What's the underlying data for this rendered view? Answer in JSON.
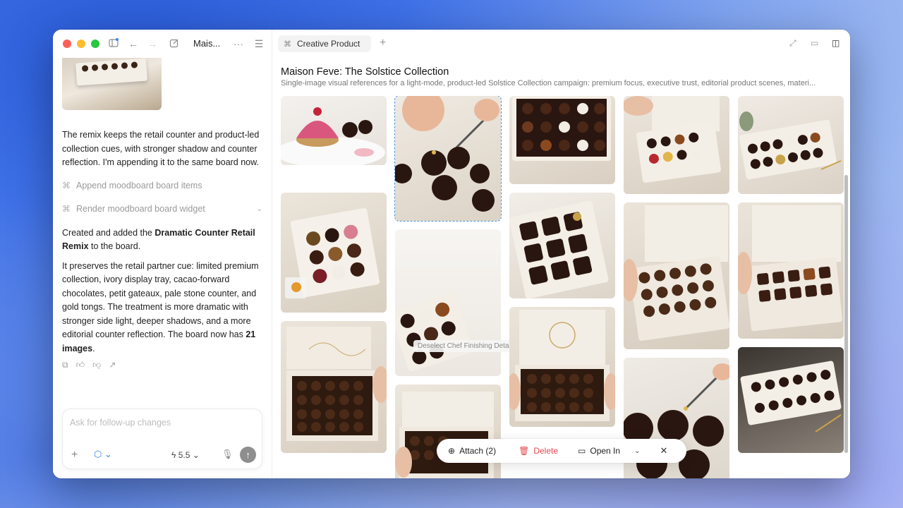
{
  "window": {
    "title": "Mais...",
    "tab_label": "Creative Product"
  },
  "chat": {
    "msg1": "The remix keeps the retail counter and product-led collection cues, with stronger shadow and counter reflection. I'm appending it to the same board now.",
    "tool1": "Append moodboard board items",
    "tool2": "Render moodboard board widget",
    "msg2_pre": "Created and added the ",
    "msg2_bold": "Dramatic Counter Retail Remix",
    "msg2_post": " to the board.",
    "msg3_pre": "It preserves the retail partner cue: limited premium collection, ivory display tray, cacao-forward chocolates, petit gateaux, pale stone counter, and gold tongs. The treatment is more dramatic with stronger side light, deeper shadows, and a more editorial counter reflection. The board now has ",
    "msg3_bold": "21 images",
    "msg3_post": "."
  },
  "composer": {
    "placeholder": "Ask for follow-up changes",
    "model": "5.5"
  },
  "board": {
    "title": "Maison Feve: The Solstice Collection",
    "subtitle": "Single-image visual references for a light-mode, product-led Solstice Collection campaign: premium focus, executive trust, editorial product scenes, materi...",
    "tooltip": "Deselect Chef Finishing Detail"
  },
  "actionbar": {
    "attach": "Attach (2)",
    "delete": "Delete",
    "open_in": "Open In"
  },
  "colors": {
    "accent": "#3b82f6",
    "delete": "#e5484d",
    "selection": "#4a90e2"
  }
}
